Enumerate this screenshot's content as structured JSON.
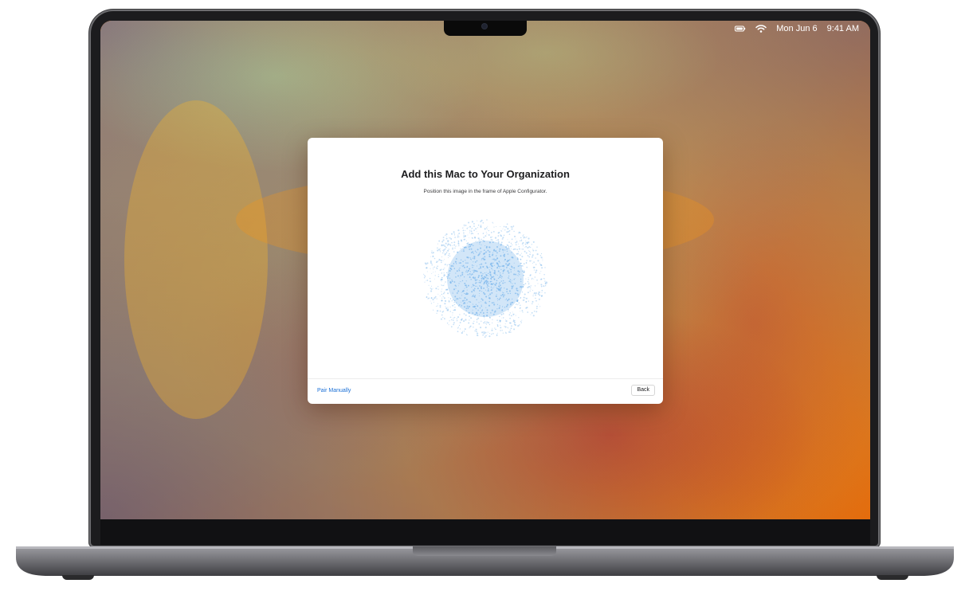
{
  "menubar": {
    "date": "Mon Jun 6",
    "time": "9:41 AM",
    "icons": [
      "battery-icon",
      "wifi-icon"
    ]
  },
  "dialog": {
    "title": "Add this Mac to Your Organization",
    "subtitle": "Position this image in the frame of Apple Configurator.",
    "pair_manually_label": "Pair Manually",
    "back_label": "Back"
  },
  "colors": {
    "accent_link": "#1a6fd6",
    "particle_blue": "#7fb8ec",
    "wallpaper_orange": "#f08a10"
  }
}
